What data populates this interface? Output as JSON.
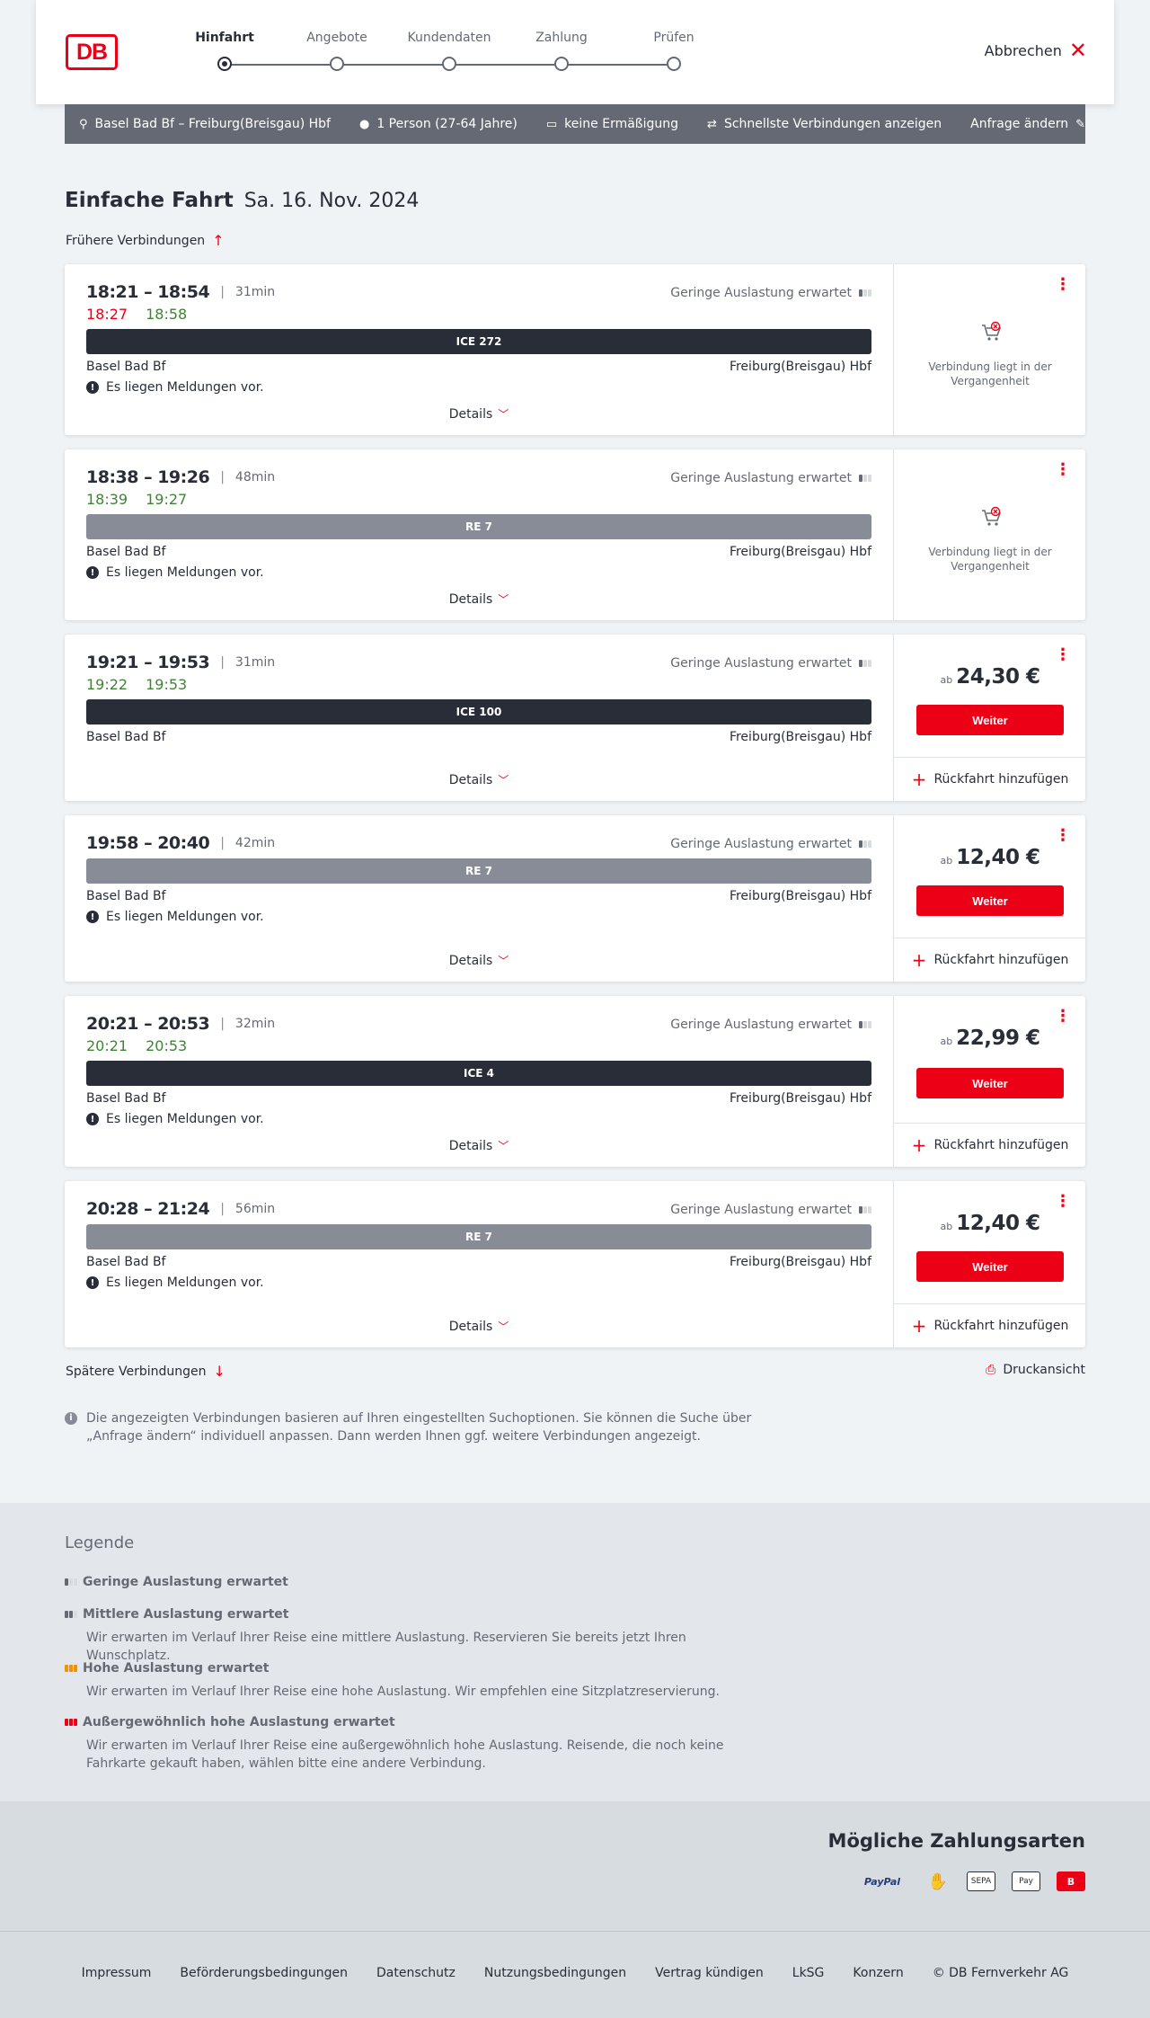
{
  "header": {
    "logo": "DB",
    "steps": [
      {
        "label": "Hinfahrt",
        "active": true
      },
      {
        "label": "Angebote",
        "active": false
      },
      {
        "label": "Kundendaten",
        "active": false
      },
      {
        "label": "Zahlung",
        "active": false
      },
      {
        "label": "Prüfen",
        "active": false
      }
    ],
    "cancel_label": "Abbrechen"
  },
  "query": {
    "route": "Basel Bad Bf – Freiburg(Breisgau) Hbf",
    "persons": "1 Person (27-64 Jahre)",
    "discount": "keine Ermäßigung",
    "fastest": "Schnellste Verbindungen anzeigen",
    "change": "Anfrage ändern"
  },
  "title": {
    "trip_type": "Einfache Fahrt",
    "date": "Sa. 16. Nov. 2024",
    "earlier": "Frühere Verbindungen",
    "later": "Spätere Verbindungen",
    "print": "Druckansicht"
  },
  "common": {
    "occupancy": "Geringe Auslastung erwartet",
    "from": "Basel Bad Bf",
    "to": "Freiburg(Breisgau) Hbf",
    "message": "Es liegen Meldungen vor.",
    "details": "Details",
    "past_text": "Verbindung liegt in der Vergangenheit",
    "ab": "ab",
    "weiter": "Weiter",
    "return": "Rückfahrt hinzufügen"
  },
  "connections": [
    {
      "times": "18:21 – 18:54",
      "duration": "31min",
      "rt_dep": "18:27",
      "rt_arr": "18:58",
      "rt_dep_late": true,
      "train": "ICE 272",
      "train_type": "ice",
      "message": true,
      "past": true,
      "price": ""
    },
    {
      "times": "18:38 – 19:26",
      "duration": "48min",
      "rt_dep": "18:39",
      "rt_arr": "19:27",
      "rt_dep_late": false,
      "train": "RE 7",
      "train_type": "re",
      "message": true,
      "past": true,
      "price": ""
    },
    {
      "times": "19:21 – 19:53",
      "duration": "31min",
      "rt_dep": "19:22",
      "rt_arr": "19:53",
      "rt_dep_late": false,
      "train": "ICE 100",
      "train_type": "ice",
      "message": false,
      "past": false,
      "price": "24,30 €"
    },
    {
      "times": "19:58 – 20:40",
      "duration": "42min",
      "rt_dep": "",
      "rt_arr": "",
      "rt_dep_late": false,
      "train": "RE 7",
      "train_type": "re",
      "message": true,
      "past": false,
      "price": "12,40 €"
    },
    {
      "times": "20:21 – 20:53",
      "duration": "32min",
      "rt_dep": "20:21",
      "rt_arr": "20:53",
      "rt_dep_late": false,
      "train": "ICE 4",
      "train_type": "ice",
      "message": true,
      "past": false,
      "price": "22,99 €"
    },
    {
      "times": "20:28 – 21:24",
      "duration": "56min",
      "rt_dep": "",
      "rt_arr": "",
      "rt_dep_late": false,
      "train": "RE 7",
      "train_type": "re",
      "message": true,
      "past": false,
      "price": "12,40 €"
    }
  ],
  "info_text": "Die angezeigten Verbindungen basieren auf Ihren eingestellten Suchoptionen. Sie können die Suche über „Anfrage ändern“ individuell anpassen. Dann werden Ihnen ggf. weitere Verbindungen angezeigt.",
  "legend": {
    "title": "Legende",
    "items": [
      {
        "title": "Geringe Auslastung erwartet",
        "desc": "",
        "level": 1,
        "color": "#646973"
      },
      {
        "title": "Mittlere Auslastung erwartet",
        "desc": "Wir erwarten im Verlauf Ihrer Reise eine mittlere Auslastung. Reservieren Sie bereits jetzt Ihren Wunschplatz.",
        "level": 2,
        "color": "#646973"
      },
      {
        "title": "Hohe Auslastung erwartet",
        "desc": "Wir erwarten im Verlauf Ihrer Reise eine hohe Auslastung. Wir empfehlen eine Sitzplatzreservierung.",
        "level": 3,
        "color": "#f39200"
      },
      {
        "title": "Außergewöhnlich hohe Auslastung erwartet",
        "desc": "Wir erwarten im Verlauf Ihrer Reise eine außergewöhnlich hohe Auslastung. Reisende, die noch keine Fahrkarte gekauft haben, wählen bitte eine andere Verbindung.",
        "level": 4,
        "color": "#ec0016"
      }
    ]
  },
  "payments": {
    "title": "Mögliche Zahlungsarten",
    "methods": [
      "PayPal",
      "Kreditkarte",
      "SEPA",
      "Apple Pay",
      "DB Gutschein"
    ]
  },
  "footer": {
    "links": [
      "Impressum",
      "Beförderungsbedingungen",
      "Datenschutz",
      "Nutzungsbedingungen",
      "Vertrag kündigen",
      "LkSG",
      "Konzern",
      "© DB Fernverkehr AG"
    ]
  }
}
